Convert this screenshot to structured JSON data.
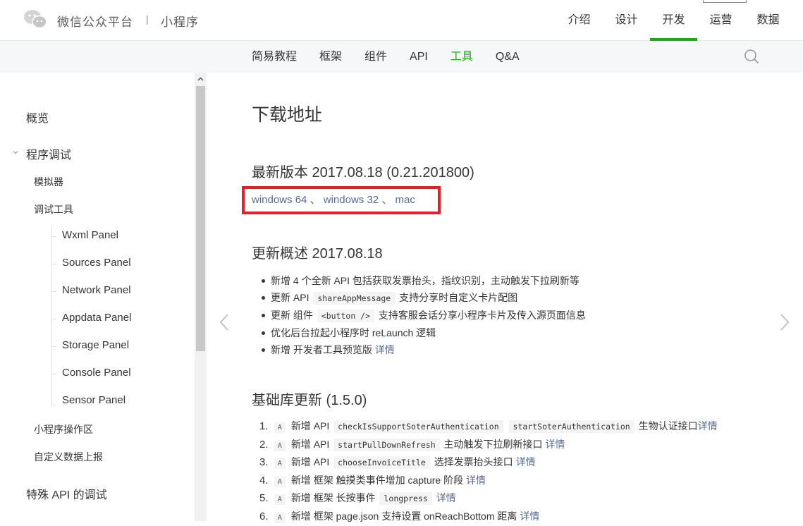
{
  "header": {
    "brand": "微信公众平台",
    "separator": "|",
    "sub_brand": "小程序",
    "nav": [
      {
        "label": "介绍",
        "active": false
      },
      {
        "label": "设计",
        "active": false
      },
      {
        "label": "开发",
        "active": true
      },
      {
        "label": "运营",
        "active": false
      },
      {
        "label": "数据",
        "active": false
      }
    ],
    "accent_color": "#1aad19"
  },
  "subnav": {
    "items": [
      {
        "label": "简易教程",
        "active": false
      },
      {
        "label": "框架",
        "active": false
      },
      {
        "label": "组件",
        "active": false
      },
      {
        "label": "API",
        "active": false
      },
      {
        "label": "工具",
        "active": true
      },
      {
        "label": "Q&A",
        "active": false
      }
    ],
    "search_icon": "search-icon"
  },
  "sidebar": {
    "items": [
      {
        "label": "概览",
        "level": 1
      },
      {
        "label": "程序调试",
        "level": 1,
        "expanded": true
      },
      {
        "label": "模拟器",
        "level": 2
      },
      {
        "label": "调试工具",
        "level": 2
      },
      {
        "label": "Wxml Panel",
        "level": 3
      },
      {
        "label": "Sources Panel",
        "level": 3
      },
      {
        "label": "Network Panel",
        "level": 3
      },
      {
        "label": "Appdata Panel",
        "level": 3
      },
      {
        "label": "Storage Panel",
        "level": 3
      },
      {
        "label": "Console Panel",
        "level": 3
      },
      {
        "label": "Sensor Panel",
        "level": 3
      },
      {
        "label": "小程序操作区",
        "level": 2
      },
      {
        "label": "自定义数据上报",
        "level": 2
      },
      {
        "label": "特殊 API 的调试",
        "level": 1
      }
    ]
  },
  "content": {
    "title": "下载地址",
    "latest_heading": "最新版本 2017.08.18 (0.21.201800)",
    "downloads": [
      {
        "label": "windows 64"
      },
      {
        "label": "windows 32"
      },
      {
        "label": "mac"
      }
    ],
    "download_separator": "、",
    "summary_heading": "更新概述 2017.08.18",
    "summary": [
      {
        "before": "新增 4 个全新 API 包括获取发票抬头，指纹识别，主动触发下拉刷新等",
        "code": "",
        "after": "",
        "link": ""
      },
      {
        "before": "更新 API",
        "code": "shareAppMessage",
        "after": "支持分享时自定义卡片配图",
        "link": ""
      },
      {
        "before": "更新 组件",
        "code": "<button />",
        "after": "支持客服会话分享小程序卡片及传入源页面信息",
        "link": ""
      },
      {
        "before": "优化后台拉起小程序时 reLaunch 逻辑",
        "code": "",
        "after": "",
        "link": ""
      },
      {
        "before": "新增 开发者工具预览版",
        "code": "",
        "after": "",
        "link": "详情"
      }
    ],
    "lib_heading": "基础库更新 (1.5.0)",
    "lib_changes": [
      {
        "num": "1.",
        "tag": "A",
        "text": "新增 API",
        "code": "checkIsSupportSoterAuthentication",
        "code2": "startSoterAuthentication",
        "after": "生物认证接口",
        "link": "详情"
      },
      {
        "num": "2.",
        "tag": "A",
        "text": "新增 API",
        "code": "startPullDownRefresh",
        "code2": "",
        "after": "主动触发下拉刷新接口",
        "link": "详情"
      },
      {
        "num": "3.",
        "tag": "A",
        "text": "新增 API",
        "code": "chooseInvoiceTitle",
        "code2": "",
        "after": "选择发票抬头接口",
        "link": "详情"
      },
      {
        "num": "4.",
        "tag": "A",
        "text": "新增 框架 触摸类事件增加 capture 阶段",
        "code": "",
        "code2": "",
        "after": "",
        "link": "详情"
      },
      {
        "num": "5.",
        "tag": "A",
        "text": "新增 框架 长按事件",
        "code": "longpress",
        "code2": "",
        "after": "",
        "link": "详情"
      },
      {
        "num": "6.",
        "tag": "A",
        "text": "新增 框架 page.json 支持设置 onReachBottom 距离",
        "code": "",
        "code2": "",
        "after": "",
        "link": "详情"
      }
    ],
    "link_color": "#576b95",
    "highlight_color": "#e5202a"
  }
}
